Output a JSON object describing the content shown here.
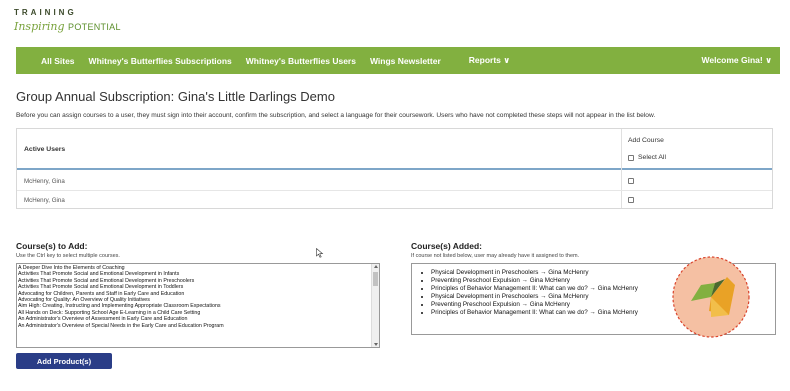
{
  "logo": {
    "top": "TRAINING",
    "script": "Inspiring",
    "word": "POTENTIAL"
  },
  "nav": {
    "items": [
      "All Sites",
      "Whitney's Butterflies Subscriptions",
      "Whitney's Butterflies Users",
      "Wings Newsletter"
    ],
    "reports": "Reports ∨",
    "welcome": "Welcome Gina! ∨"
  },
  "page": {
    "title": "Group Annual Subscription: Gina's Little Darlings Demo",
    "intro": "Before you can assign courses to a user, they must sign into their account, confirm the subscription, and select a language for their coursework. Users who have not completed these steps will not appear in the list below."
  },
  "users_table": {
    "col_active": "Active Users",
    "col_add": "Add Course",
    "select_all": "Select All",
    "rows": [
      "McHenry, Gina",
      "McHenry, Gina"
    ]
  },
  "courses_to_add": {
    "heading": "Course(s) to Add:",
    "hint": "Use the Ctrl key to select multiple courses.",
    "items": [
      "A Deeper Dive Into the Elements of Coaching",
      "Activities That Promote Social and Emotional Development in Infants",
      "Activities That Promote Social and Emotional Development in Preschoolers",
      "Activities That Promote Social and Emotional Development in Toddlers",
      "Advocating for Children, Parents and Staff in Early Care and Education",
      "Advocating for Quality: An Overview of Quality Initiatives",
      "Aim High: Creating, Instructing and Implementing Appropriate Classroom Expectations",
      "All Hands on Deck: Supporting School Age E-Learning in a Child Care Setting",
      "An Administrator's Overview of Assessment in Early Care and Education",
      "An Administrator's Overview of Special Needs in the Early Care and Education Program"
    ],
    "button": "Add Product(s)"
  },
  "courses_added": {
    "heading": "Course(s) Added:",
    "hint": "If course not listed below, user may already have it assigned to them.",
    "items": [
      "Physical Development in Preschoolers → Gina McHenry",
      "Preventing Preschool Expulsion → Gina McHenry",
      "Principles of Behavior Management II: What can we do? → Gina McHenry",
      "Physical Development in Preschoolers → Gina McHenry",
      "Preventing Preschool Expulsion → Gina McHenry",
      "Principles of Behavior Management II: What can we do? → Gina McHenry"
    ]
  },
  "colors": {
    "nav_green": "#82b040",
    "button_navy": "#2a3d87",
    "badge_peach": "#f5c0a3",
    "badge_border": "#d9442c"
  }
}
